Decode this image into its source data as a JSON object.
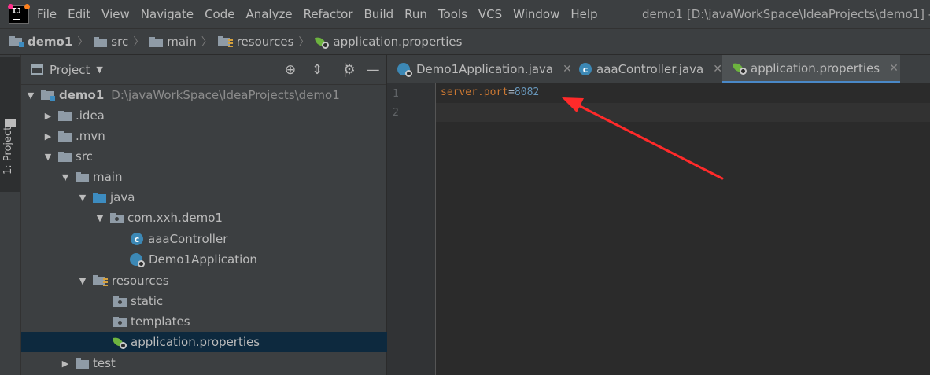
{
  "menubar": {
    "items": [
      "File",
      "Edit",
      "View",
      "Navigate",
      "Code",
      "Analyze",
      "Refactor",
      "Build",
      "Run",
      "Tools",
      "VCS",
      "Window",
      "Help"
    ],
    "window_title": "demo1 [D:\\javaWorkSpace\\IdeaProjects\\demo1] -"
  },
  "navbar": {
    "crumbs": [
      "demo1",
      "src",
      "main",
      "resources",
      "application.properties"
    ]
  },
  "left_strip": {
    "tab_label": "1: Project"
  },
  "project_panel": {
    "title": "Project",
    "tree": [
      {
        "label": "demo1",
        "path": "D:\\javaWorkSpace\\IdeaProjects\\demo1"
      },
      {
        "label": ".idea"
      },
      {
        "label": ".mvn"
      },
      {
        "label": "src"
      },
      {
        "label": "main"
      },
      {
        "label": "java"
      },
      {
        "label": "com.xxh.demo1"
      },
      {
        "label": "aaaController"
      },
      {
        "label": "Demo1Application"
      },
      {
        "label": "resources"
      },
      {
        "label": "static"
      },
      {
        "label": "templates"
      },
      {
        "label": "application.properties"
      },
      {
        "label": "test"
      }
    ]
  },
  "editor": {
    "tabs": [
      "Demo1Application.java",
      "aaaController.java",
      "application.properties"
    ],
    "active_tab": "application.properties",
    "line_numbers": [
      "1",
      "2"
    ],
    "line1": {
      "key": "server.port",
      "eq": "=",
      "value": "8082"
    }
  },
  "colors": {
    "annotation_arrow": "#ff2a2a",
    "selection": "#0d293e",
    "accent": "#4a88c7"
  },
  "icons": {
    "class": "class-c-icon",
    "spring": "spring-leaf-icon",
    "folder": "folder-icon"
  }
}
